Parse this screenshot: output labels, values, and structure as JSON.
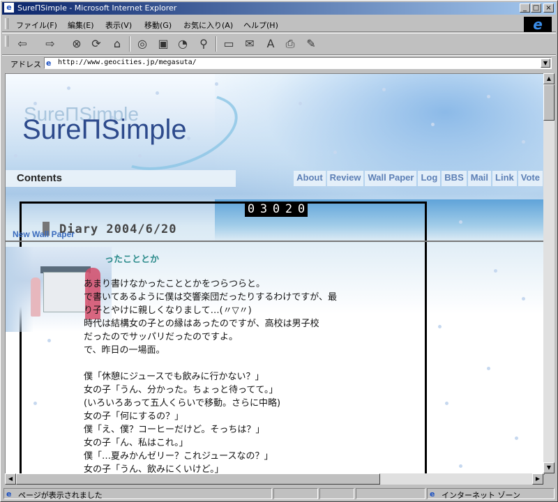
{
  "window": {
    "title": "SureΠSimple - Microsoft Internet Explorer",
    "min_label": "_",
    "max_label": "□",
    "close_label": "×"
  },
  "menu": {
    "items": [
      "ファイル(F)",
      "編集(E)",
      "表示(V)",
      "移動(G)",
      "お気に入り(A)",
      "ヘルプ(H)"
    ]
  },
  "toolbar": {
    "icons": [
      {
        "name": "back-icon",
        "glyph": "⇦"
      },
      {
        "name": "forward-icon",
        "glyph": "⇨"
      },
      {
        "name": "stop-icon",
        "glyph": "⊗"
      },
      {
        "name": "refresh-icon",
        "glyph": "⟳"
      },
      {
        "name": "home-icon",
        "glyph": "⌂"
      },
      {
        "name": "search-icon",
        "glyph": "🔍"
      },
      {
        "name": "favorites-icon",
        "glyph": "▣"
      },
      {
        "name": "history-icon",
        "glyph": "◔"
      },
      {
        "name": "channels-icon",
        "glyph": "⚲"
      },
      {
        "name": "fullscreen-icon",
        "glyph": "▭"
      },
      {
        "name": "mail-icon",
        "glyph": "✉"
      },
      {
        "name": "font-icon",
        "glyph": "A"
      },
      {
        "name": "print-icon",
        "glyph": "⎙"
      },
      {
        "name": "edit-icon",
        "glyph": "✎"
      }
    ]
  },
  "address": {
    "label": "アドレス",
    "url": "http://www.geocities.jp/megasuta/"
  },
  "page": {
    "logo_main": "SureΠSimple",
    "logo_ghost": "SureΠSimple",
    "contents_label": "Contents",
    "nav_links": [
      "About",
      "Review",
      "Wall Paper",
      "Log",
      "BBS",
      "Mail",
      "Link",
      "Vote"
    ],
    "counter": "03020",
    "diary_title": "Diary 2004/6/20",
    "new_wall_paper": "New Wall Paper",
    "heading": "ったこととか",
    "body_lines": [
      "あまり書けなかったこととかをつらつらと。",
      "で書いてあるように僕は交響楽団だったりするわけですが、最",
      "り子とやけに親しくなりまして…(〃▽〃)",
      "時代は結構女の子との縁はあったのですが、高校は男子校",
      "だったのでサッパリだったのですよ。",
      "で、昨日の一場面。",
      "",
      "僕「休憩にジュースでも飲みに行かない？」",
      "女の子「うん、分かった。ちょっと待ってて。」",
      "(いろいろあって五人くらいで移動。さらに中略)",
      "女の子「何にするの？」",
      "僕「え、僕？コーヒーだけど。そっちは？」",
      "女の子「ん、私はこれ。」",
      "僕「…夏みかんゼリー？これジュースなの？」",
      "女の子「うん、飲みにくいけど。」"
    ]
  },
  "status": {
    "text": "ページが表示されました",
    "zone": "インターネット ゾーン"
  },
  "colors": {
    "title_bar": "#0a246a",
    "nav_link": "#5c7fb5",
    "heading": "#2d8c8c",
    "logo": "#2d4a8c"
  }
}
